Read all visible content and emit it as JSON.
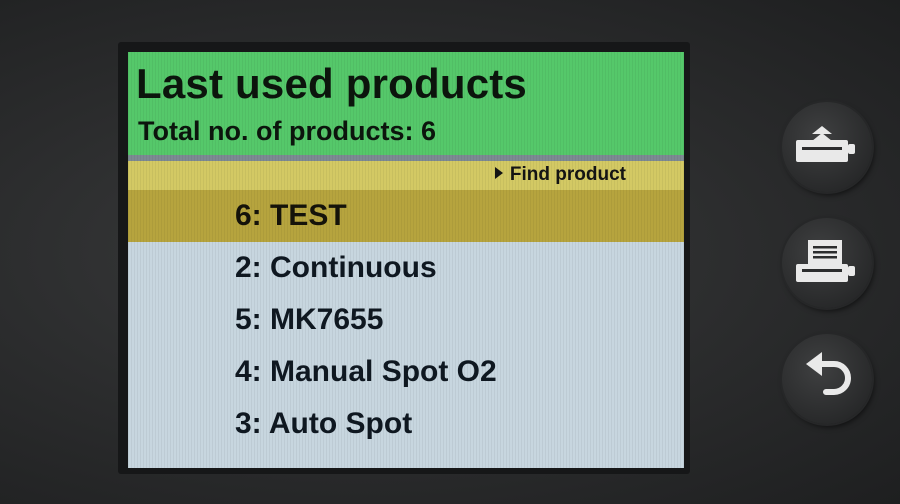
{
  "header": {
    "title": "Last used products",
    "subtitle": "Total no. of products: 6"
  },
  "find_product": {
    "label": "Find product",
    "icon": "play-arrow-icon"
  },
  "products": [
    {
      "label": "6: TEST",
      "selected": true
    },
    {
      "label": "2: Continuous",
      "selected": false
    },
    {
      "label": "5: MK7655",
      "selected": false
    },
    {
      "label": "4: Manual Spot O2",
      "selected": false
    },
    {
      "label": "3: Auto Spot",
      "selected": false
    }
  ],
  "side_buttons": [
    {
      "name": "paper-feed-button",
      "icon": "paper-feed-icon"
    },
    {
      "name": "print-button",
      "icon": "printer-icon"
    },
    {
      "name": "back-button",
      "icon": "back-arrow-icon"
    }
  ],
  "colors": {
    "header_green": "#55c86a",
    "find_bar_yellow": "#d3c964",
    "selected_row": "#b6a43e",
    "list_background": "#c7d6df"
  }
}
